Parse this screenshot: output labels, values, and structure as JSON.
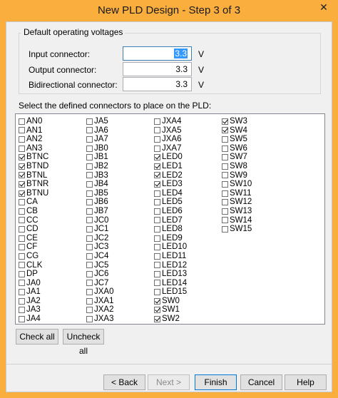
{
  "window": {
    "title": "New PLD Design - Step 3 of 3",
    "close_symbol": "✕"
  },
  "voltages": {
    "group_label": "Default operating voltages",
    "input_label": "Input connector:",
    "input_value": "3.3",
    "output_label": "Output connector:",
    "output_value": "3.3",
    "bidir_label": "Bidirectional connector:",
    "bidir_value": "3.3",
    "unit": "V"
  },
  "connectors": {
    "label": "Select the defined connectors to place on the PLD:",
    "columns": [
      [
        {
          "name": "AN0",
          "checked": false
        },
        {
          "name": "AN1",
          "checked": false
        },
        {
          "name": "AN2",
          "checked": false
        },
        {
          "name": "AN3",
          "checked": false
        },
        {
          "name": "BTNC",
          "checked": true
        },
        {
          "name": "BTND",
          "checked": true
        },
        {
          "name": "BTNL",
          "checked": true
        },
        {
          "name": "BTNR",
          "checked": true
        },
        {
          "name": "BTNU",
          "checked": true
        },
        {
          "name": "CA",
          "checked": false
        },
        {
          "name": "CB",
          "checked": false
        },
        {
          "name": "CC",
          "checked": false
        },
        {
          "name": "CD",
          "checked": false
        },
        {
          "name": "CE",
          "checked": false
        },
        {
          "name": "CF",
          "checked": false
        },
        {
          "name": "CG",
          "checked": false
        },
        {
          "name": "CLK",
          "checked": false
        },
        {
          "name": "DP",
          "checked": false
        },
        {
          "name": "JA0",
          "checked": false
        },
        {
          "name": "JA1",
          "checked": false
        },
        {
          "name": "JA2",
          "checked": false
        },
        {
          "name": "JA3",
          "checked": false
        },
        {
          "name": "JA4",
          "checked": false
        }
      ],
      [
        {
          "name": "JA5",
          "checked": false
        },
        {
          "name": "JA6",
          "checked": false
        },
        {
          "name": "JA7",
          "checked": false
        },
        {
          "name": "JB0",
          "checked": false
        },
        {
          "name": "JB1",
          "checked": false
        },
        {
          "name": "JB2",
          "checked": false
        },
        {
          "name": "JB3",
          "checked": false
        },
        {
          "name": "JB4",
          "checked": false
        },
        {
          "name": "JB5",
          "checked": false
        },
        {
          "name": "JB6",
          "checked": false
        },
        {
          "name": "JB7",
          "checked": false
        },
        {
          "name": "JC0",
          "checked": false
        },
        {
          "name": "JC1",
          "checked": false
        },
        {
          "name": "JC2",
          "checked": false
        },
        {
          "name": "JC3",
          "checked": false
        },
        {
          "name": "JC4",
          "checked": false
        },
        {
          "name": "JC5",
          "checked": false
        },
        {
          "name": "JC6",
          "checked": false
        },
        {
          "name": "JC7",
          "checked": false
        },
        {
          "name": "JXA0",
          "checked": false
        },
        {
          "name": "JXA1",
          "checked": false
        },
        {
          "name": "JXA2",
          "checked": false
        },
        {
          "name": "JXA3",
          "checked": false
        }
      ],
      [
        {
          "name": "JXA4",
          "checked": false
        },
        {
          "name": "JXA5",
          "checked": false
        },
        {
          "name": "JXA6",
          "checked": false
        },
        {
          "name": "JXA7",
          "checked": false
        },
        {
          "name": "LED0",
          "checked": true
        },
        {
          "name": "LED1",
          "checked": true
        },
        {
          "name": "LED2",
          "checked": true
        },
        {
          "name": "LED3",
          "checked": true
        },
        {
          "name": "LED4",
          "checked": false
        },
        {
          "name": "LED5",
          "checked": false
        },
        {
          "name": "LED6",
          "checked": false
        },
        {
          "name": "LED7",
          "checked": false
        },
        {
          "name": "LED8",
          "checked": false
        },
        {
          "name": "LED9",
          "checked": false
        },
        {
          "name": "LED10",
          "checked": false
        },
        {
          "name": "LED11",
          "checked": false
        },
        {
          "name": "LED12",
          "checked": false
        },
        {
          "name": "LED13",
          "checked": false
        },
        {
          "name": "LED14",
          "checked": false
        },
        {
          "name": "LED15",
          "checked": false
        },
        {
          "name": "SW0",
          "checked": true
        },
        {
          "name": "SW1",
          "checked": true
        },
        {
          "name": "SW2",
          "checked": true
        }
      ],
      [
        {
          "name": "SW3",
          "checked": true
        },
        {
          "name": "SW4",
          "checked": true
        },
        {
          "name": "SW5",
          "checked": false
        },
        {
          "name": "SW6",
          "checked": false
        },
        {
          "name": "SW7",
          "checked": false
        },
        {
          "name": "SW8",
          "checked": false
        },
        {
          "name": "SW9",
          "checked": false
        },
        {
          "name": "SW10",
          "checked": false
        },
        {
          "name": "SW11",
          "checked": false
        },
        {
          "name": "SW12",
          "checked": false
        },
        {
          "name": "SW13",
          "checked": false
        },
        {
          "name": "SW14",
          "checked": false
        },
        {
          "name": "SW15",
          "checked": false
        }
      ]
    ]
  },
  "buttons": {
    "check_all": "Check all",
    "uncheck_all": "Uncheck all",
    "back": "< Back",
    "next": "Next >",
    "finish": "Finish",
    "cancel": "Cancel",
    "help": "Help"
  }
}
